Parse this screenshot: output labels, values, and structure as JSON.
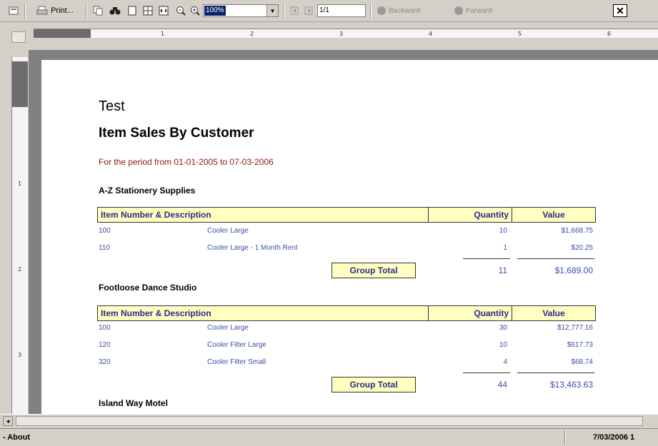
{
  "toolbar": {
    "print_label": "Print...",
    "zoom_value": "100%",
    "page_value": "1/1",
    "backward_label": "Backward",
    "forward_label": "Forward"
  },
  "report": {
    "title": "Test",
    "heading": "Item Sales By Customer",
    "period": "For the period  from 01-01-2005 to 07-03-2006",
    "columns": {
      "desc": "Item Number & Description",
      "qty": "Quantity",
      "value": "Value"
    },
    "group_total_label": "Group Total",
    "groups": [
      {
        "customer": "A-Z Stationery Supplies",
        "rows": [
          {
            "num": "100",
            "desc": "Cooler Large",
            "qty": "10",
            "value": "$1,668.75"
          },
          {
            "num": "110",
            "desc": "Cooler Large - 1 Month Rent",
            "qty": "1",
            "value": "$20.25"
          }
        ],
        "total_qty": "11",
        "total_value": "$1,689.00"
      },
      {
        "customer": "Footloose Dance Studio",
        "rows": [
          {
            "num": "100",
            "desc": "Cooler Large",
            "qty": "30",
            "value": "$12,777.16"
          },
          {
            "num": "120",
            "desc": "Cooler Filter Large",
            "qty": "10",
            "value": "$617.73"
          },
          {
            "num": "320",
            "desc": "Cooler Filter Small",
            "qty": "4",
            "value": "$68.74"
          }
        ],
        "total_qty": "44",
        "total_value": "$13,463.63"
      },
      {
        "customer": "Island Way Motel"
      }
    ]
  },
  "status": {
    "left": "- About",
    "right": "7/03/2006 1"
  }
}
